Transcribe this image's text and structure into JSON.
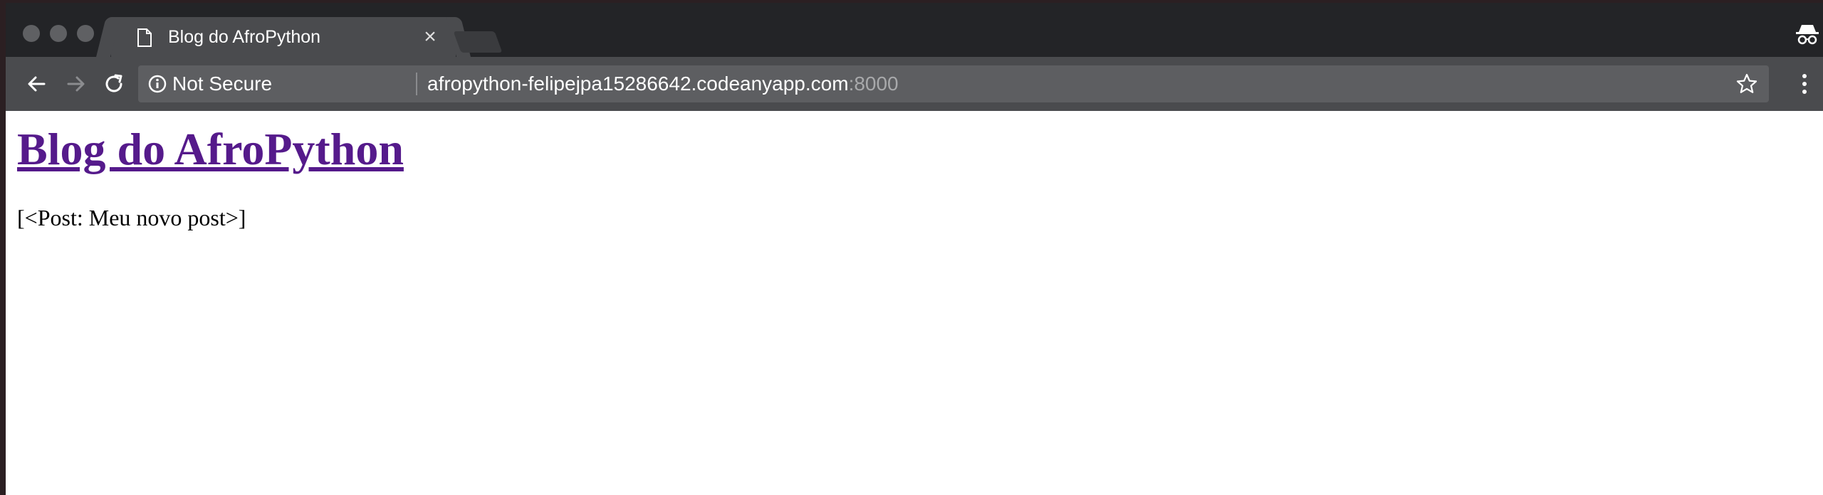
{
  "browser": {
    "tab": {
      "title": "Blog do AfroPython",
      "close_glyph": "×",
      "icon": "document-icon"
    },
    "toolbar": {
      "security_label": "Not Secure",
      "url_host": "afropython-felipejpa15286642.codeanyapp.com",
      "url_port": ":8000",
      "icons": [
        "back-arrow-icon",
        "forward-arrow-icon",
        "reload-icon",
        "info-icon",
        "star-icon",
        "more-vert-icon"
      ]
    },
    "incognito_icon": "incognito-icon",
    "colors": {
      "tabstrip": "#232427",
      "toolbar": "#4a4b4e",
      "omnibox": "#5d5e61",
      "link_visited": "#551a8b"
    }
  },
  "page": {
    "heading": "Blog do AfroPython",
    "posts_text": "[<Post: Meu novo post>]"
  }
}
